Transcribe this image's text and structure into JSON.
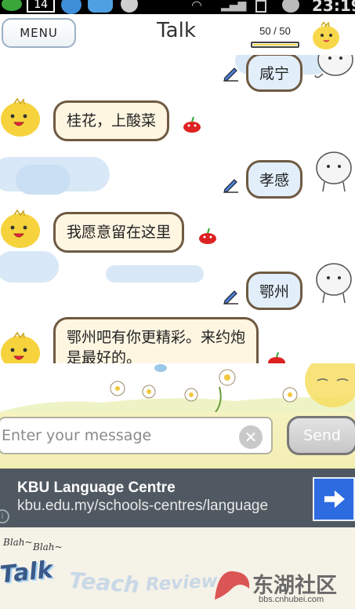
{
  "status_bar": {
    "date_badge": "14",
    "time": "23:19",
    "icons": [
      "sync-icon",
      "calendar-icon",
      "app-icon",
      "chat-icon",
      "moon-icon",
      "wifi-icon",
      "signal-icon",
      "battery-icon",
      "alarm-icon"
    ]
  },
  "header": {
    "menu_label": "MENU",
    "title": "Talk",
    "counter": "50 / 50",
    "counter_fill": 1.0
  },
  "chat": {
    "messages": [
      {
        "side": "right",
        "text": "咸宁"
      },
      {
        "side": "left",
        "text": "桂花，上酸菜"
      },
      {
        "side": "right",
        "text": "孝感"
      },
      {
        "side": "left",
        "text": "我愿意留在这里"
      },
      {
        "side": "right",
        "text": "鄂州"
      },
      {
        "side": "left",
        "text": "鄂州吧有你更精彩。来约炮是最好的。"
      }
    ]
  },
  "input": {
    "placeholder": "Enter your message",
    "clear_label": "✕",
    "send_label": "Send"
  },
  "ad": {
    "title": "KBU Language Centre",
    "url": "kbu.edu.my/schools-centres/language",
    "info_label": "i"
  },
  "tabs": {
    "blah1": "Blah~",
    "blah2": "Blah~",
    "talk": "Talk",
    "teach": "Teach",
    "review": "Review"
  },
  "watermark": {
    "title": "东湖社区",
    "url": "bbs.cnhubei.com"
  },
  "colors": {
    "bubble_border": "#6e5a42",
    "right_bubble_bg": "#e2effb",
    "left_bubble_bg": "#fff6e2",
    "ad_bg": "#505962",
    "ad_button": "#2d6be0",
    "input_area_bg": "#f7f3c0"
  }
}
